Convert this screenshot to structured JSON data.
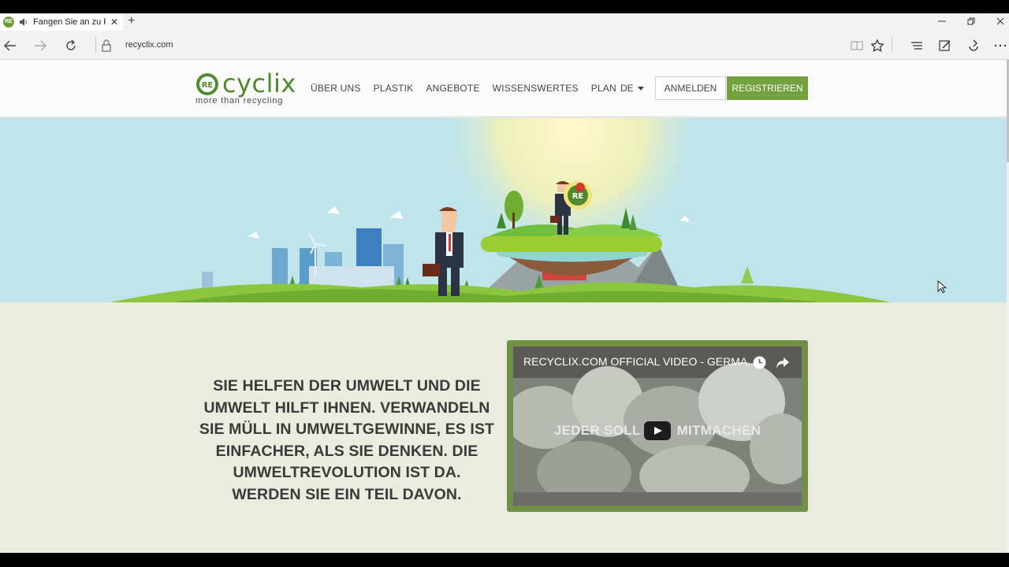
{
  "browser": {
    "tab_title": "Fangen Sie an zu Re",
    "tab_close": "✕",
    "new_tab": "+",
    "url": "recyclix.com",
    "favicon_text": "RE"
  },
  "site": {
    "logo_mark": "RE",
    "logo_word": "cyclix",
    "logo_tagline": "more than recycling",
    "nav": [
      "ÜBER UNS",
      "PLASTIK",
      "ANGEBOTE",
      "WISSENSWERTES",
      "PLAN"
    ],
    "language": "DE",
    "login_label": "ANMELDEN",
    "register_label": "REGISTRIEREN",
    "brand_color": "#72a23f"
  },
  "hero": {
    "sign_text": "RE"
  },
  "content": {
    "tagline": "SIE HELFEN DER UMWELT UND DIE UMWELT HILFT IHNEN. VERWANDELN SIE MÜLL IN UMWELTGEWINNE, ES IST EINFACHER, ALS SIE DENKEN. DIE UMWELTREVOLUTION IST DA. WERDEN SIE EIN TEIL DAVON.",
    "video": {
      "title": "RECYCLIX.COM OFFICIAL VIDEO - GERMA...",
      "overlay_left": "JEDER SOLL",
      "overlay_right": "MITMACHEN"
    }
  },
  "icons": {
    "back": "arrow-left-icon",
    "forward": "arrow-right-icon",
    "refresh": "refresh-icon",
    "lock": "lock-icon",
    "reading": "reading-view-icon",
    "favorite": "star-icon",
    "hub": "hub-icon",
    "note": "web-note-icon",
    "share": "share-icon",
    "more": "more-icon"
  }
}
